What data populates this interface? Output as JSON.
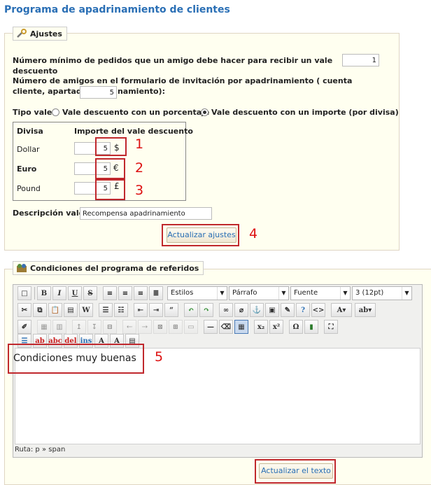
{
  "page": {
    "title": "Programa de apadrinamiento de clientes"
  },
  "settings": {
    "legend": "Ajustes",
    "min_orders_label": "Número mínimo de pedidos que un amigo debe hacer para recibir un vale descuento",
    "min_orders_value": "1",
    "friends_label": "Número de amigos en el formulario de invitación por apadrinamiento ( cuenta cliente, apartado apadrinamiento):",
    "friends_value": "5",
    "voucher_type_label": "Tipo vale:",
    "voucher_option_percent": "Vale descuento con un porcentaje",
    "voucher_option_amount": "Vale descuento con un importe (por divisa)",
    "voucher_selected": "amount",
    "currency_table": {
      "header_currency": "Divisa",
      "header_amount": "Importe del vale descuento",
      "rows": [
        {
          "name": "Dollar",
          "value": "5",
          "symbol": "$",
          "bold": false
        },
        {
          "name": "Euro",
          "value": "5",
          "symbol": "€",
          "bold": true
        },
        {
          "name": "Pound",
          "value": "5",
          "symbol": "£",
          "bold": false
        }
      ]
    },
    "description_label": "Descripción vale:",
    "description_value": "Recompensa apadrinamiento",
    "update_button": "Actualizar ajustes"
  },
  "conditions": {
    "legend": "Condiciones del programa de referidos",
    "toolbar": {
      "styles_select": "Estilos",
      "format_select": "Párrafo",
      "font_select": "Fuente",
      "size_select": "3 (12pt)"
    },
    "content": "Condiciones muy buenas",
    "path_label": "Ruta: p » span",
    "update_button": "Actualizar el texto"
  },
  "annotations": [
    "1",
    "2",
    "3",
    "4",
    "5"
  ],
  "colors": {
    "annotation": "#c0282d",
    "title": "#2a6fb5",
    "panel_bg": "#fffff0"
  }
}
